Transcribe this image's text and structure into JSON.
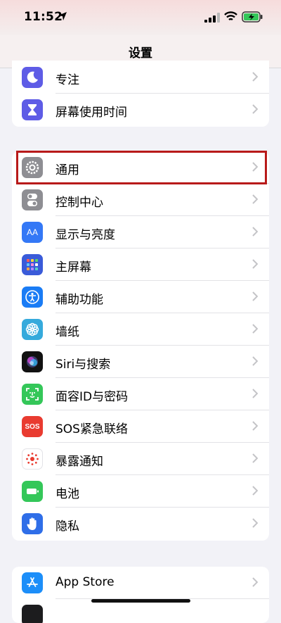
{
  "status": {
    "time": "11:52"
  },
  "nav": {
    "title": "设置"
  },
  "group1": [
    {
      "label": "专注",
      "icon": "moon-icon",
      "color": "#5e5ce6"
    },
    {
      "label": "屏幕使用时间",
      "icon": "hourglass-icon",
      "color": "#5e5ce6"
    }
  ],
  "group2": [
    {
      "label": "通用",
      "icon": "gear-icon",
      "color": "#8e8e93"
    },
    {
      "label": "控制中心",
      "icon": "toggle-icon",
      "color": "#8e8e93"
    },
    {
      "label": "显示与亮度",
      "icon": "text-size-icon",
      "color": "#3478f6",
      "glyph": "AA"
    },
    {
      "label": "主屏幕",
      "icon": "home-grid-icon",
      "color": "#3a5bd9"
    },
    {
      "label": "辅助功能",
      "icon": "accessibility-icon",
      "color": "#1a7cf5"
    },
    {
      "label": "墙纸",
      "icon": "flower-icon",
      "color": "#35aadc"
    },
    {
      "label": "Siri与搜索",
      "icon": "siri-icon",
      "color": "#111111"
    },
    {
      "label": "面容ID与密码",
      "icon": "face-id-icon",
      "color": "#34c759"
    },
    {
      "label": "SOS紧急联络",
      "icon": "sos-icon",
      "color": "#e93b30",
      "glyph": "SOS"
    },
    {
      "label": "暴露通知",
      "icon": "exposure-icon",
      "color": "#ffffff"
    },
    {
      "label": "电池",
      "icon": "battery-icon",
      "color": "#34c759"
    },
    {
      "label": "隐私",
      "icon": "hand-icon",
      "color": "#2f6ee8"
    }
  ],
  "group3": [
    {
      "label": "App Store",
      "icon": "app-store-icon",
      "color": "#1c8ef9"
    }
  ]
}
